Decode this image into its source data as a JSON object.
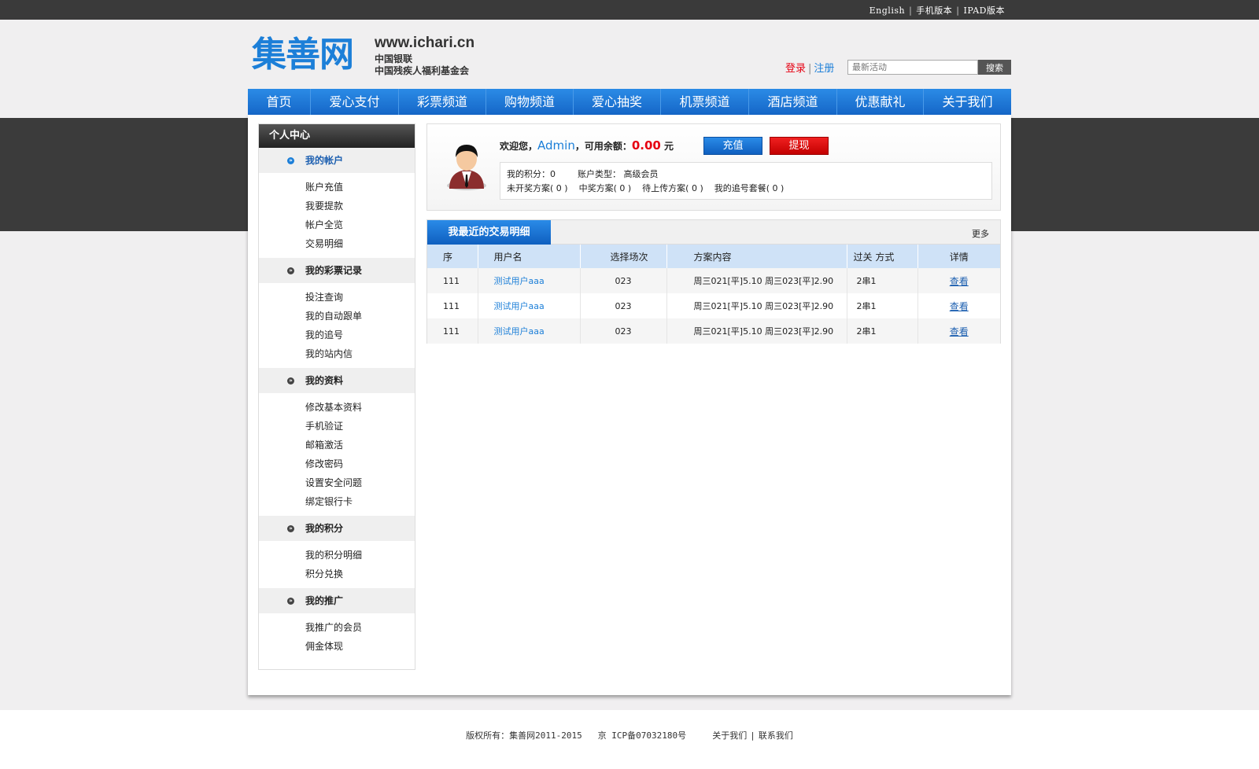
{
  "topbar": {
    "links": [
      "English",
      "手机版本",
      "IPAD版本"
    ]
  },
  "logo": {
    "main": "集善网",
    "url": "www.ichari.cn",
    "sub1": "中国银联",
    "sub2": "中国残疾人福利基金会"
  },
  "auth": {
    "login": "登录",
    "separator": "|",
    "register": "注册"
  },
  "search": {
    "placeholder": "最新活动",
    "button": "搜索"
  },
  "nav": [
    "首页",
    "爱心支付",
    "彩票频道",
    "购物频道",
    "爱心抽奖",
    "机票频道",
    "酒店频道",
    "优惠献礼",
    "关于我们"
  ],
  "sidebar": {
    "title": "个人中心",
    "groups": [
      {
        "title": "我的帐户",
        "items": [
          "账户充值",
          "我要提款",
          "帐户全览",
          "交易明细"
        ]
      },
      {
        "title": "我的彩票记录",
        "items": [
          "投注查询",
          "我的自动跟单",
          "我的追号",
          "我的站内信"
        ]
      },
      {
        "title": "我的资料",
        "items": [
          "修改基本资料",
          "手机验证",
          "邮箱激活",
          "修改密码",
          "设置安全问题",
          "绑定银行卡"
        ]
      },
      {
        "title": "我的积分",
        "items": [
          "我的积分明细",
          "积分兑换"
        ]
      },
      {
        "title": "我的推广",
        "items": [
          "我推广的会员",
          "佣金体现"
        ]
      }
    ]
  },
  "account": {
    "welcome_prefix": "欢迎您，",
    "username": "Admin",
    "balance_label": "，可用余额：",
    "balance": "0.00",
    "currency": "元",
    "recharge": "充值",
    "withdraw": "提现",
    "points": "我的积分：0",
    "account_type": "账户类型： 高级会员",
    "unopened": "未开奖方案( 0 )",
    "won": "中奖方案( 0 )",
    "pending_upload": "待上传方案( 0 )",
    "chase": "我的追号套餐( 0 )"
  },
  "transactions": {
    "title": "我最近的交易明细",
    "more": "更多",
    "headers": [
      "序",
      "用户名",
      "选择场次",
      "方案内容",
      "过关 方式",
      "详情"
    ],
    "rows": [
      [
        "111",
        "测试用户aaa",
        "023",
        "周三021[平]5.10 周三023[平]2.90",
        "2串1",
        "查看"
      ],
      [
        "111",
        "测试用户aaa",
        "023",
        "周三021[平]5.10 周三023[平]2.90",
        "2串1",
        "查看"
      ],
      [
        "111",
        "测试用户aaa",
        "023",
        "周三021[平]5.10 周三023[平]2.90",
        "2串1",
        "查看"
      ]
    ]
  },
  "footer": {
    "copyright": "版权所有：集善网2011-2015",
    "icp": "京 ICP备07032180号",
    "about": "关于我们",
    "separator": "|",
    "contact": "联系我们"
  }
}
